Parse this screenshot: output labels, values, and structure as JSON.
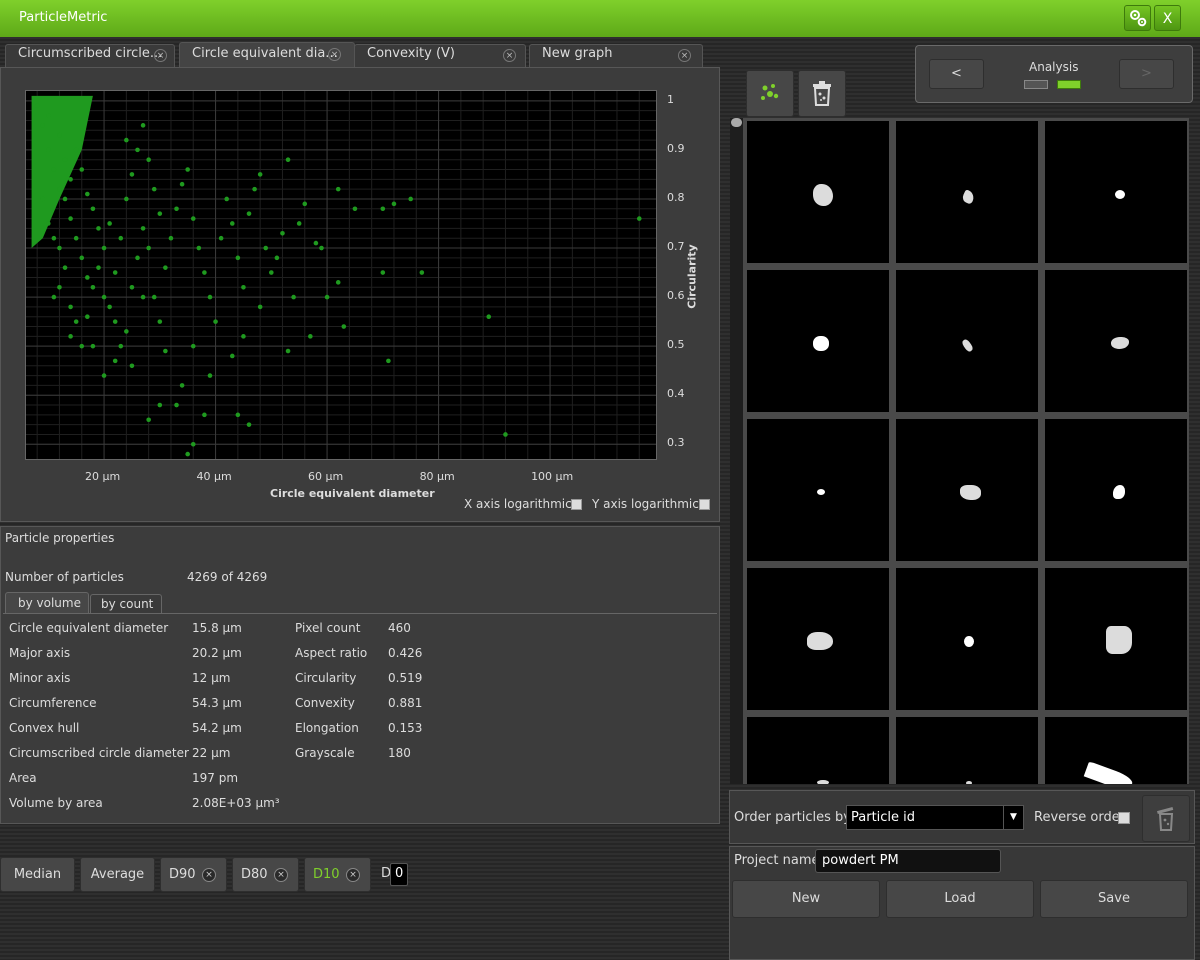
{
  "app": {
    "title": "ParticleMetric",
    "close_label": "X"
  },
  "tabs": [
    {
      "label": "Circumscribed circle..."
    },
    {
      "label": "Circle equivalent dia..."
    },
    {
      "label": "Convexity (V)"
    },
    {
      "label": "New graph"
    }
  ],
  "tab_close": "×",
  "chart_data": {
    "type": "scatter",
    "xlabel": "Circle equivalent diameter",
    "ylabel": "Circularity",
    "x_tick_labels": [
      "20 µm",
      "40 µm",
      "60 µm",
      "80 µm",
      "100 µm"
    ],
    "x_ticks": [
      20,
      40,
      60,
      80,
      100
    ],
    "xlim": [
      6,
      119
    ],
    "y_ticks": [
      0.3,
      0.4,
      0.5,
      0.6,
      0.7,
      0.8,
      0.9,
      1
    ],
    "y_tick_labels": [
      "0.3",
      "0.4",
      "0.5",
      "0.6",
      "0.7",
      "0.8",
      "0.9",
      "1"
    ],
    "ylim": [
      0.27,
      1.02
    ],
    "grid": true,
    "point_color": "#1f9a1f",
    "points": [
      [
        8,
        0.99
      ],
      [
        9,
        0.95
      ],
      [
        10,
        0.9
      ],
      [
        11,
        0.86
      ],
      [
        12,
        0.82
      ],
      [
        13,
        0.8
      ],
      [
        14,
        0.76
      ],
      [
        15,
        0.72
      ],
      [
        10,
        0.97
      ],
      [
        12,
        0.93
      ],
      [
        13,
        0.88
      ],
      [
        14,
        0.84
      ],
      [
        15,
        0.9
      ],
      [
        16,
        0.86
      ],
      [
        17,
        0.81
      ],
      [
        18,
        0.78
      ],
      [
        19,
        0.74
      ],
      [
        20,
        0.7
      ],
      [
        16,
        0.68
      ],
      [
        17,
        0.64
      ],
      [
        18,
        0.62
      ],
      [
        20,
        0.6
      ],
      [
        21,
        0.58
      ],
      [
        22,
        0.65
      ],
      [
        23,
        0.72
      ],
      [
        24,
        0.8
      ],
      [
        25,
        0.85
      ],
      [
        26,
        0.9
      ],
      [
        27,
        0.95
      ],
      [
        28,
        0.88
      ],
      [
        29,
        0.82
      ],
      [
        30,
        0.77
      ],
      [
        22,
        0.55
      ],
      [
        23,
        0.5
      ],
      [
        24,
        0.53
      ],
      [
        25,
        0.62
      ],
      [
        26,
        0.68
      ],
      [
        27,
        0.74
      ],
      [
        28,
        0.7
      ],
      [
        29,
        0.6
      ],
      [
        30,
        0.55
      ],
      [
        31,
        0.66
      ],
      [
        32,
        0.72
      ],
      [
        33,
        0.78
      ],
      [
        34,
        0.83
      ],
      [
        35,
        0.86
      ],
      [
        36,
        0.76
      ],
      [
        37,
        0.7
      ],
      [
        38,
        0.65
      ],
      [
        39,
        0.6
      ],
      [
        40,
        0.55
      ],
      [
        41,
        0.72
      ],
      [
        42,
        0.8
      ],
      [
        43,
        0.75
      ],
      [
        44,
        0.68
      ],
      [
        45,
        0.62
      ],
      [
        46,
        0.77
      ],
      [
        47,
        0.82
      ],
      [
        48,
        0.85
      ],
      [
        49,
        0.7
      ],
      [
        50,
        0.65
      ],
      [
        52,
        0.73
      ],
      [
        53,
        0.88
      ],
      [
        54,
        0.6
      ],
      [
        55,
        0.75
      ],
      [
        56,
        0.79
      ],
      [
        58,
        0.71
      ],
      [
        59,
        0.7
      ],
      [
        60,
        0.6
      ],
      [
        62,
        0.82
      ],
      [
        63,
        0.54
      ],
      [
        65,
        0.78
      ],
      [
        70,
        0.78
      ],
      [
        70,
        0.65
      ],
      [
        71,
        0.47
      ],
      [
        75,
        0.8
      ],
      [
        77,
        0.65
      ],
      [
        18,
        0.5
      ],
      [
        20,
        0.44
      ],
      [
        22,
        0.47
      ],
      [
        25,
        0.46
      ],
      [
        28,
        0.35
      ],
      [
        30,
        0.38
      ],
      [
        33,
        0.38
      ],
      [
        35,
        0.28
      ],
      [
        36,
        0.3
      ],
      [
        38,
        0.36
      ],
      [
        44,
        0.36
      ],
      [
        46,
        0.34
      ],
      [
        53,
        0.49
      ],
      [
        57,
        0.52
      ],
      [
        62,
        0.63
      ],
      [
        72,
        0.79
      ],
      [
        11,
        0.6
      ],
      [
        12,
        0.7
      ],
      [
        13,
        0.66
      ],
      [
        14,
        0.58
      ],
      [
        15,
        0.55
      ],
      [
        16,
        0.5
      ],
      [
        17,
        0.56
      ],
      [
        19,
        0.66
      ],
      [
        21,
        0.75
      ],
      [
        24,
        0.92
      ],
      [
        27,
        0.6
      ],
      [
        31,
        0.49
      ],
      [
        34,
        0.42
      ],
      [
        36,
        0.5
      ],
      [
        39,
        0.44
      ],
      [
        43,
        0.48
      ],
      [
        45,
        0.52
      ],
      [
        48,
        0.58
      ],
      [
        51,
        0.68
      ],
      [
        9,
        0.8
      ],
      [
        10,
        0.75
      ],
      [
        11,
        0.72
      ],
      [
        12,
        0.62
      ],
      [
        14,
        0.52
      ],
      [
        89,
        0.56
      ],
      [
        92,
        0.32
      ],
      [
        116,
        0.76
      ]
    ]
  },
  "axis_options": {
    "x_log_label": "X axis logarithmic",
    "y_log_label": "Y axis logarithmic"
  },
  "properties": {
    "title": "Particle properties",
    "count_label": "Number of particles",
    "count_value": "4269 of 4269",
    "subtabs": [
      "by volume",
      "by count"
    ],
    "left": [
      {
        "label": "Circle equivalent diameter",
        "value": "15.8 µm"
      },
      {
        "label": "Major axis",
        "value": "20.2 µm"
      },
      {
        "label": "Minor axis",
        "value": "12 µm"
      },
      {
        "label": "Circumference",
        "value": "54.3 µm"
      },
      {
        "label": "Convex hull",
        "value": "54.2 µm"
      },
      {
        "label": "Circumscribed circle diameter",
        "value": "22 µm"
      },
      {
        "label": "Area",
        "value": "197 pm"
      },
      {
        "label": "Volume by area",
        "value": "2.08E+03 µm³"
      }
    ],
    "right": [
      {
        "label": "Pixel count",
        "value": "460"
      },
      {
        "label": "Aspect ratio",
        "value": "0.426"
      },
      {
        "label": "Circularity",
        "value": "0.519"
      },
      {
        "label": "Convexity",
        "value": "0.881"
      },
      {
        "label": "Elongation",
        "value": "0.153"
      },
      {
        "label": "Grayscale",
        "value": "180"
      }
    ]
  },
  "stats": {
    "median": "Median",
    "average": "Average",
    "d90": "D90",
    "d80": "D80",
    "d10": "D10",
    "d_label": "D",
    "d_value": "0",
    "accent": "#7fd02b"
  },
  "analysis": {
    "prev": "<",
    "label": "Analysis",
    "next": ">"
  },
  "gallery": {
    "order_label": "Order particles by",
    "order_value": "Particle id",
    "reverse_label": "Reverse order",
    "project_label": "Project name",
    "project_value": "powdert PM",
    "new_button": "New",
    "load_button": "Load",
    "save_button": "Save"
  }
}
